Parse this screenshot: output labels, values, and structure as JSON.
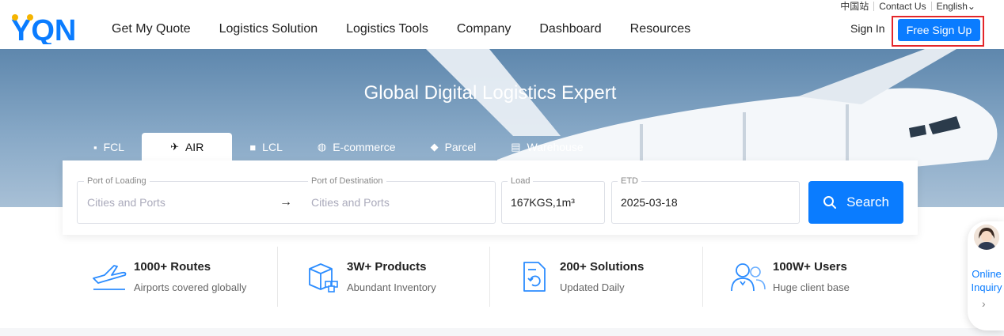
{
  "header": {
    "logo_text": "YQN",
    "nav": [
      "Get My Quote",
      "Logistics Solution",
      "Logistics Tools",
      "Company",
      "Dashboard",
      "Resources"
    ],
    "util_links": [
      "中国站",
      "Contact Us",
      "English⌄"
    ],
    "sign_in": "Sign In",
    "sign_up": "Free Sign Up"
  },
  "hero": {
    "title": "Global Digital Logistics Expert",
    "tabs": [
      {
        "label": "FCL",
        "icon": "container-icon",
        "glyph": "▪"
      },
      {
        "label": "AIR",
        "icon": "airplane-icon",
        "glyph": "✈"
      },
      {
        "label": "LCL",
        "icon": "box-icon",
        "glyph": "■"
      },
      {
        "label": "E-commerce",
        "icon": "globe-icon",
        "glyph": "◍"
      },
      {
        "label": "Parcel",
        "icon": "parcel-icon",
        "glyph": "◆"
      },
      {
        "label": "Warehouse",
        "icon": "warehouse-icon",
        "glyph": "▤"
      }
    ],
    "active_tab": "AIR"
  },
  "search": {
    "port_loading_label": "Port of Loading",
    "port_loading_placeholder": "Cities and Ports",
    "arrow": "→",
    "port_dest_label": "Port of Destination",
    "port_dest_placeholder": "Cities and Ports",
    "load_label": "Load",
    "load_value": "167KGS,1m³",
    "etd_label": "ETD",
    "etd_value": "2025-03-18",
    "button": "Search"
  },
  "stats": [
    {
      "title": "1000+ Routes",
      "sub": "Airports covered globally",
      "icon": "plane-route-icon"
    },
    {
      "title": "3W+ Products",
      "sub": "Abundant Inventory",
      "icon": "inventory-boxes-icon"
    },
    {
      "title": "200+ Solutions",
      "sub": "Updated Daily",
      "icon": "document-refresh-icon"
    },
    {
      "title": "100W+ Users",
      "sub": "Huge client base",
      "icon": "users-icon"
    }
  ],
  "inquiry": {
    "label_line1": "Online",
    "label_line2": "Inquiry",
    "chevron": "›"
  },
  "colors": {
    "accent": "#0a7cff",
    "highlight_border": "#e3262a",
    "hero_top": "#5e87ad"
  }
}
